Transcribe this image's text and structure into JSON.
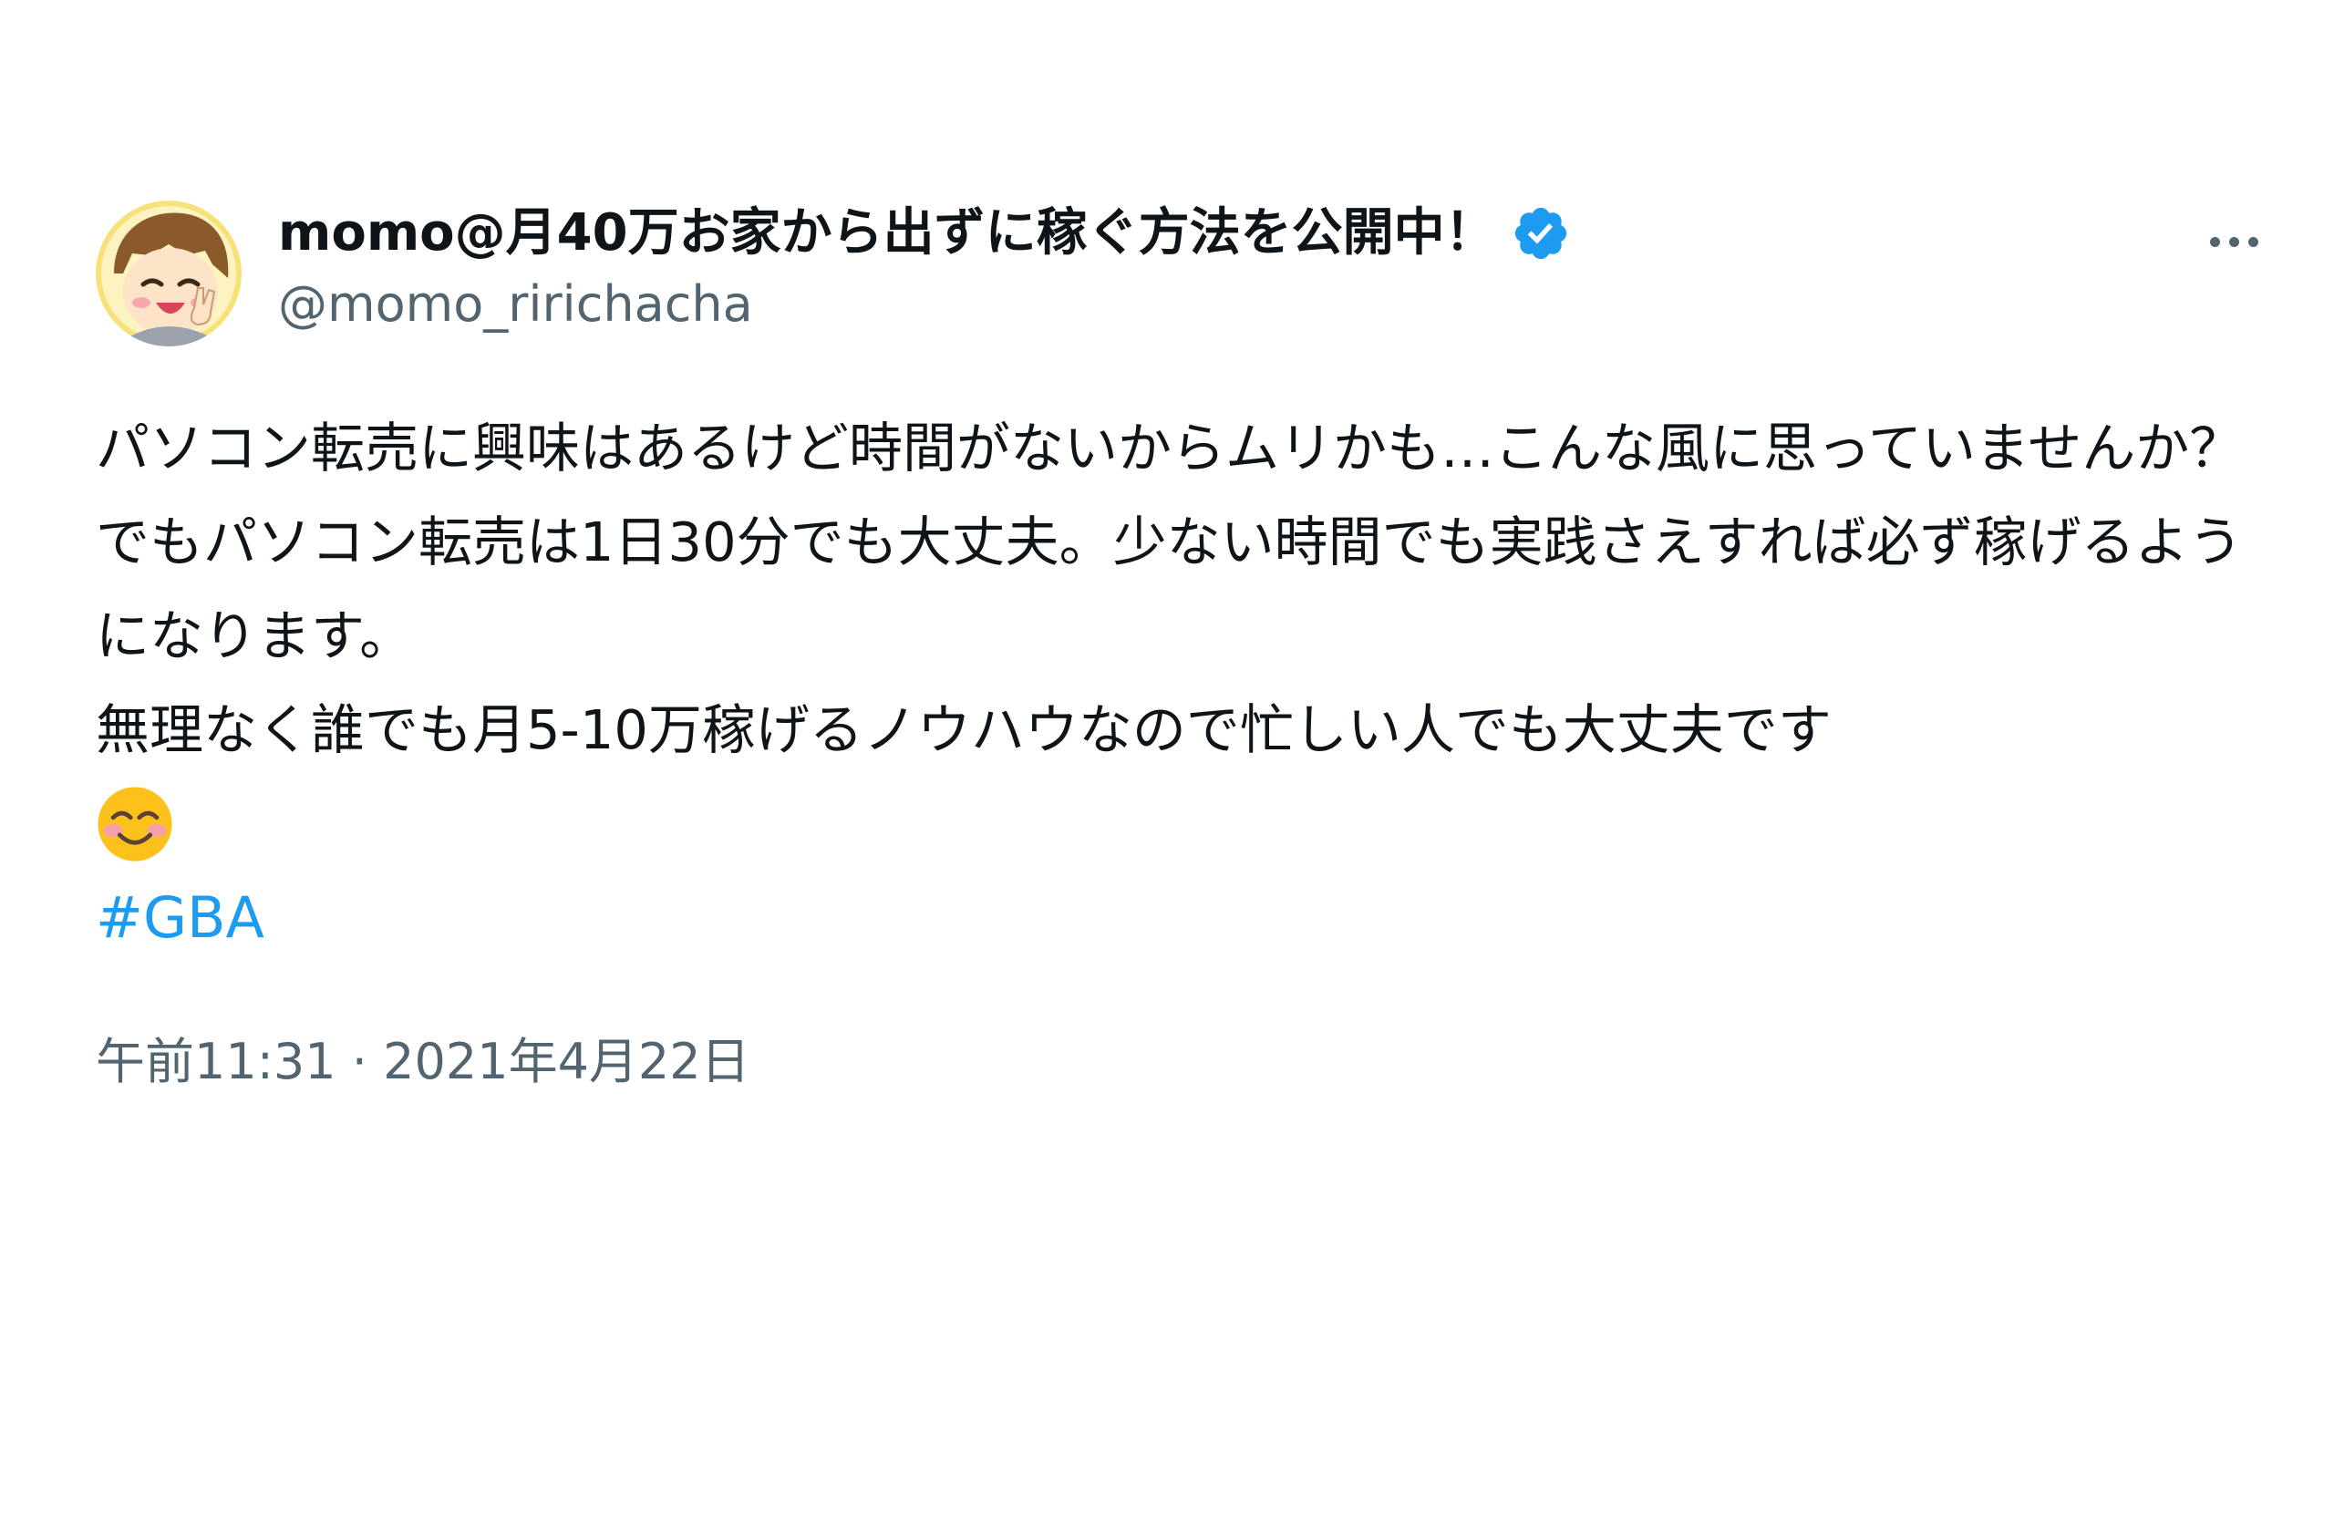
{
  "tweet": {
    "author": {
      "display_name": "momo@月40万お家から出ずに稼ぐ方法を公開中！",
      "handle": "@momo_ririchacha",
      "verified_icon": "verified-badge-icon",
      "avatar_icon": "cartoon-avatar"
    },
    "more_icon": "more-dots-icon",
    "body_lines": [
      "パソコン転売に興味はあるけど時間がないからムリかも…こんな風に思っていませんか？",
      "でもパソコン転売は1日30分でも大丈夫。少ない時間でも実践さえすれば必ず稼げるようになります。",
      "無理なく誰でも月5-10万稼げるノウハウなので忙しい人でも大丈夫です"
    ],
    "emoji": "😊",
    "hashtag": "#GBA",
    "time": "午前11:31",
    "separator": "·",
    "date": "2021年4月22日"
  },
  "colors": {
    "text": "#0f1419",
    "secondary": "#536471",
    "link": "#1d9bf0",
    "verified": "#1d9bf0"
  }
}
